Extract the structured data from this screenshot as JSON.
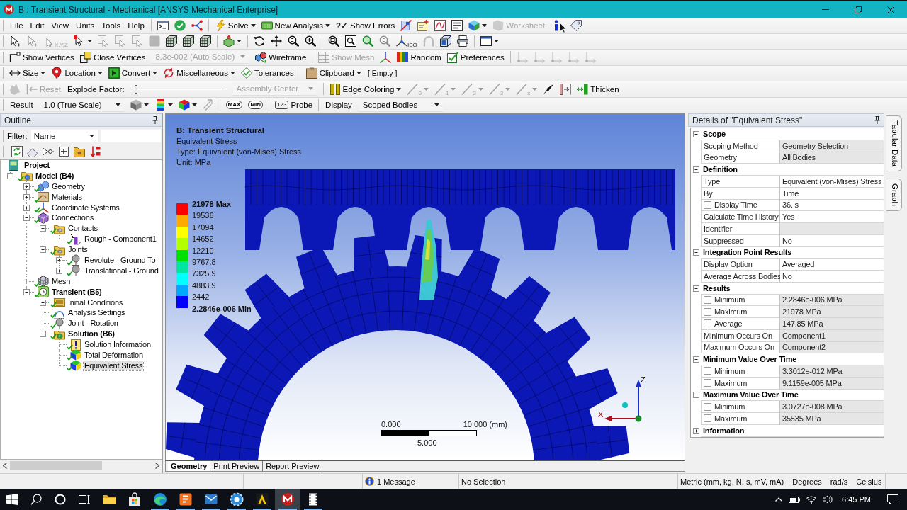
{
  "window": {
    "title": "B : Transient Structural - Mechanical [ANSYS Mechanical Enterprise]"
  },
  "menu_bar": [
    "File",
    "Edit",
    "View",
    "Units",
    "Tools",
    "Help"
  ],
  "toolbar_rows": [
    {
      "groups": [
        [
          {
            "kind": "console",
            "disabled": false
          },
          {
            "kind": "check",
            "disabled": false
          },
          {
            "kind": "graph",
            "disabled": false
          }
        ],
        [
          {
            "kind": "solve",
            "label": "Solve",
            "menu": true,
            "disabled": false
          },
          {
            "kind": "analysis",
            "label": "New Analysis",
            "menu": true,
            "disabled": false
          },
          {
            "kind": "errors",
            "badge": "?✓",
            "label": "Show Errors",
            "disabled": false
          },
          {
            "kind": "section",
            "disabled": false
          },
          {
            "kind": "annotation",
            "disabled": false
          },
          {
            "kind": "chart",
            "disabled": false
          },
          {
            "kind": "textbox",
            "disabled": false
          },
          {
            "kind": "cube",
            "menu": true,
            "disabled": false
          },
          {
            "kind": "worksheet",
            "label": "Worksheet",
            "disabled": true
          },
          {
            "kind": "info",
            "disabled": false
          },
          {
            "kind": "tag",
            "disabled": false
          }
        ]
      ]
    },
    {
      "groups": [
        [
          {
            "kind": "select",
            "disabled": false
          },
          {
            "kind": "select",
            "disabled": true
          },
          {
            "kind": "coords",
            "badge": "X,Y,Z",
            "disabled": true
          },
          {
            "kind": "mode",
            "menu": true,
            "disabled": false
          },
          {
            "kind": "face",
            "disabled": true
          },
          {
            "kind": "face",
            "disabled": true
          },
          {
            "kind": "face",
            "disabled": true
          },
          {
            "kind": "block",
            "disabled": true
          },
          {
            "kind": "lattice",
            "disabled": false
          },
          {
            "kind": "lattice",
            "disabled": false
          },
          {
            "kind": "lattice",
            "disabled": false
          }
        ],
        [
          {
            "kind": "extend",
            "menu": true,
            "disabled": false
          }
        ],
        [
          {
            "kind": "rotate",
            "disabled": false
          },
          {
            "kind": "pan",
            "disabled": false
          },
          {
            "kind": "zoom",
            "disabled": false
          },
          {
            "kind": "zoomin",
            "disabled": false
          }
        ],
        [
          {
            "kind": "zoombox",
            "disabled": false
          },
          {
            "kind": "zoomfit",
            "disabled": false
          },
          {
            "kind": "zoomgo",
            "disabled": false
          },
          {
            "kind": "zoom",
            "disabled": true
          },
          {
            "kind": "iso",
            "badge": "ISO",
            "disabled": false
          },
          {
            "kind": "back",
            "disabled": true
          },
          {
            "kind": "box",
            "disabled": false
          },
          {
            "kind": "print",
            "disabled": false
          }
        ],
        [
          {
            "kind": "window",
            "menu": true,
            "disabled": false
          }
        ]
      ]
    },
    {
      "groups": [
        [
          {
            "kind": "vertex",
            "label": "Show Vertices",
            "disabled": false
          },
          {
            "kind": "merge",
            "label": "Close Vertices",
            "disabled": false
          },
          {
            "kind": "combo",
            "value": "8.3e-002 (Auto Scale)",
            "disabled": true
          },
          {
            "kind": "wireframe",
            "label": "Wireframe",
            "disabled": false
          }
        ],
        [
          {
            "kind": "mesh",
            "label": "Show Mesh",
            "disabled": true
          },
          {
            "kind": "triad",
            "disabled": false
          },
          {
            "kind": "palette",
            "label": "Random",
            "disabled": false
          },
          {
            "kind": "preferences",
            "label": "Preferences",
            "disabled": false
          }
        ],
        [
          {
            "kind": "axes",
            "disabled": true
          },
          {
            "kind": "axes",
            "disabled": true
          },
          {
            "kind": "axes",
            "disabled": true
          },
          {
            "kind": "axes",
            "disabled": true
          },
          {
            "kind": "axes",
            "disabled": true
          }
        ]
      ]
    },
    {
      "groups": [
        [
          {
            "kind": "size",
            "label": "Size",
            "menu": true,
            "disabled": false
          },
          {
            "kind": "location",
            "label": "Location",
            "menu": true,
            "disabled": false
          },
          {
            "kind": "convert",
            "label": "Convert",
            "menu": true,
            "disabled": false
          },
          {
            "kind": "misc",
            "label": "Miscellaneous",
            "menu": true,
            "disabled": false
          },
          {
            "kind": "tolerance",
            "label": "Tolerances",
            "disabled": false
          }
        ],
        [
          {
            "kind": "clipboard",
            "label": "Clipboard",
            "menu": true,
            "disabled": false
          },
          {
            "kind": "note",
            "label": "[ Empty ]",
            "disabled": false
          }
        ]
      ]
    },
    {
      "groups": [
        [
          {
            "kind": "explode",
            "disabled": true
          },
          {
            "kind": "reset",
            "label": "Reset",
            "disabled": true
          },
          {
            "kind": "text",
            "label": "Explode Factor:",
            "disabled": false
          },
          {
            "kind": "slider",
            "level": 0
          },
          {
            "kind": "combo",
            "value": "Assembly Center",
            "disabled": true
          }
        ],
        [
          {
            "kind": "edges",
            "label": "Edge Coloring",
            "menu": true,
            "disabled": false
          },
          {
            "kind": "edge",
            "badge": "0",
            "menu": true,
            "disabled": true
          },
          {
            "kind": "edge",
            "badge": "1",
            "menu": true,
            "disabled": true
          },
          {
            "kind": "edge",
            "badge": "2",
            "menu": true,
            "disabled": true
          },
          {
            "kind": "edge",
            "badge": "3",
            "menu": true,
            "disabled": true
          },
          {
            "kind": "edge",
            "badge": "x",
            "menu": true,
            "disabled": true
          },
          {
            "kind": "pin",
            "disabled": false
          },
          {
            "kind": "shell",
            "disabled": false
          },
          {
            "kind": "thicken",
            "label": "Thicken",
            "disabled": false
          }
        ]
      ]
    },
    {
      "groups": [
        [
          {
            "kind": "text",
            "label": "Result",
            "disabled": false
          },
          {
            "kind": "combo",
            "value": "1.0 (True Scale)",
            "disabled": false
          },
          {
            "kind": "solid",
            "menu": true,
            "disabled": false
          },
          {
            "kind": "legend",
            "menu": true,
            "disabled": false
          },
          {
            "kind": "contour",
            "menu": true,
            "disabled": false
          },
          {
            "kind": "vectors",
            "disabled": true
          }
        ],
        [
          {
            "kind": "marker",
            "label": "MAX",
            "disabled": false
          },
          {
            "kind": "marker",
            "label": "MIN",
            "disabled": false
          }
        ],
        [
          {
            "kind": "probe",
            "badge": "123",
            "label": "Probe",
            "disabled": false
          }
        ],
        [
          {
            "kind": "text",
            "label": "Display",
            "disabled": false
          },
          {
            "kind": "combo",
            "value": "Scoped Bodies",
            "disabled": false
          }
        ]
      ]
    }
  ],
  "outline": {
    "title": "Outline",
    "filter": {
      "label": "Filter:",
      "value": "Name"
    },
    "tree": [
      {
        "label": "Project",
        "kind": "project",
        "bold": true,
        "complete": false,
        "selected": false,
        "children": [
          {
            "label": "Model (B4)",
            "kind": "model",
            "bold": true,
            "complete": true,
            "expanded": true,
            "selected": false,
            "children": [
              {
                "label": "Geometry",
                "kind": "geometry",
                "bold": false,
                "complete": true,
                "expanded": false,
                "selected": false
              },
              {
                "label": "Materials",
                "kind": "materials",
                "bold": false,
                "complete": true,
                "expanded": false,
                "selected": false
              },
              {
                "label": "Coordinate Systems",
                "kind": "coordinates",
                "bold": false,
                "complete": true,
                "expanded": false,
                "selected": false
              },
              {
                "label": "Connections",
                "kind": "connections",
                "bold": false,
                "complete": true,
                "expanded": true,
                "selected": false,
                "children": [
                  {
                    "label": "Contacts",
                    "kind": "group",
                    "bold": false,
                    "complete": true,
                    "expanded": true,
                    "selected": false,
                    "children": [
                      {
                        "label": "Rough - Component1",
                        "kind": "contact",
                        "bold": false,
                        "complete": true,
                        "selected": false
                      }
                    ]
                  },
                  {
                    "label": "Joints",
                    "kind": "group",
                    "bold": false,
                    "complete": true,
                    "expanded": true,
                    "selected": false,
                    "children": [
                      {
                        "label": "Revolute - Ground To",
                        "kind": "joint",
                        "bold": false,
                        "complete": true,
                        "expanded": false,
                        "selected": false
                      },
                      {
                        "label": "Translational - Ground",
                        "kind": "joint",
                        "bold": false,
                        "complete": true,
                        "expanded": false,
                        "selected": false
                      }
                    ]
                  }
                ]
              },
              {
                "label": "Mesh",
                "kind": "mesh",
                "bold": false,
                "complete": true,
                "selected": false
              },
              {
                "label": "Transient (B5)",
                "kind": "transient",
                "bold": true,
                "complete": true,
                "expanded": true,
                "selected": false,
                "children": [
                  {
                    "label": "Initial Conditions",
                    "kind": "initial",
                    "bold": false,
                    "complete": true,
                    "expanded": false,
                    "selected": false
                  },
                  {
                    "label": "Analysis Settings",
                    "kind": "settings",
                    "bold": false,
                    "complete": true,
                    "selected": false
                  },
                  {
                    "label": "Joint - Rotation",
                    "kind": "joint",
                    "bold": false,
                    "complete": true,
                    "selected": false
                  },
                  {
                    "label": "Solution (B6)",
                    "kind": "solution",
                    "bold": true,
                    "complete": true,
                    "expanded": true,
                    "selected": false,
                    "children": [
                      {
                        "label": "Solution Information",
                        "kind": "info",
                        "bold": false,
                        "complete": true,
                        "selected": false
                      },
                      {
                        "label": "Total Deformation",
                        "kind": "result",
                        "bold": false,
                        "complete": true,
                        "selected": false
                      },
                      {
                        "label": "Equivalent Stress",
                        "kind": "result",
                        "bold": false,
                        "complete": true,
                        "selected": true
                      }
                    ]
                  }
                ]
              }
            ]
          }
        ]
      }
    ]
  },
  "viewport": {
    "heading": "B: Transient Structural",
    "lines": [
      "Equivalent Stress",
      "Type: Equivalent (von-Mises) Stress",
      "Unit: MPa"
    ],
    "legend": {
      "bands": [
        {
          "color": "#ff0000"
        },
        {
          "color": "#ffaa00"
        },
        {
          "color": "#ffff00"
        },
        {
          "color": "#b4ff00"
        },
        {
          "color": "#00e000"
        },
        {
          "color": "#00e6a0"
        },
        {
          "color": "#00ffff"
        },
        {
          "color": "#00a8ff"
        },
        {
          "color": "#0000ff"
        }
      ],
      "labels": [
        "21978 Max",
        "19536",
        "17094",
        "14652",
        "12210",
        "9767.8",
        "7325.9",
        "4883.9",
        "2442",
        "2.2846e-006 Min"
      ]
    },
    "scale": {
      "start": "0.000",
      "end": "10.000 (mm)",
      "middle": "5.000"
    },
    "triad": {
      "z": "Z",
      "x": "X"
    },
    "tabs": [
      {
        "label": "Geometry",
        "selected": true
      },
      {
        "label": "Print Preview",
        "selected": false
      },
      {
        "label": "Report Preview",
        "selected": false
      }
    ]
  },
  "details": {
    "title": "Details of \"Equivalent Stress\"",
    "groups": [
      {
        "name": "Scope",
        "expanded": true,
        "rows": [
          {
            "kind": "field",
            "label": "Scoping Method",
            "value": "Geometry Selection",
            "readonly": true
          },
          {
            "kind": "field",
            "label": "Geometry",
            "value": "All Bodies",
            "readonly": true
          }
        ]
      },
      {
        "name": "Definition",
        "expanded": true,
        "rows": [
          {
            "kind": "field",
            "label": "Type",
            "value": "Equivalent (von-Mises) Stress",
            "readonly": false
          },
          {
            "kind": "field",
            "label": "By",
            "value": "Time",
            "readonly": false
          },
          {
            "kind": "check",
            "label": "Display Time",
            "value": "36. s",
            "readonly": false,
            "checked": false
          },
          {
            "kind": "field",
            "label": "Calculate Time History",
            "value": "Yes",
            "readonly": false
          },
          {
            "kind": "field",
            "label": "Identifier",
            "readonly": true
          },
          {
            "kind": "field",
            "label": "Suppressed",
            "value": "No",
            "readonly": false
          }
        ]
      },
      {
        "name": "Integration Point Results",
        "expanded": true,
        "rows": [
          {
            "kind": "field",
            "label": "Display Option",
            "value": "Averaged",
            "readonly": false
          },
          {
            "kind": "field",
            "label": "Average Across Bodies",
            "value": "No",
            "readonly": false
          }
        ]
      },
      {
        "name": "Results",
        "expanded": true,
        "rows": [
          {
            "kind": "check",
            "label": "Minimum",
            "value": "2.2846e-006 MPa",
            "readonly": true,
            "checked": false
          },
          {
            "kind": "check",
            "label": "Maximum",
            "value": "21978 MPa",
            "readonly": true,
            "checked": false
          },
          {
            "kind": "check",
            "label": "Average",
            "value": "147.85 MPa",
            "readonly": true,
            "checked": false
          },
          {
            "kind": "field",
            "label": "Minimum Occurs On",
            "value": "Component1",
            "readonly": true
          },
          {
            "kind": "field",
            "label": "Maximum Occurs On",
            "value": "Component2",
            "readonly": true
          }
        ]
      },
      {
        "name": "Minimum Value Over Time",
        "expanded": true,
        "rows": [
          {
            "kind": "check",
            "label": "Minimum",
            "value": "3.3012e-012 MPa",
            "readonly": true,
            "checked": false
          },
          {
            "kind": "check",
            "label": "Maximum",
            "value": "9.1159e-005 MPa",
            "readonly": true,
            "checked": false
          }
        ]
      },
      {
        "name": "Maximum Value Over Time",
        "expanded": true,
        "rows": [
          {
            "kind": "check",
            "label": "Minimum",
            "value": "3.0727e-008 MPa",
            "readonly": true,
            "checked": false
          },
          {
            "kind": "check",
            "label": "Maximum",
            "value": "35535 MPa",
            "readonly": true,
            "checked": false
          }
        ]
      },
      {
        "name": "Information",
        "expanded": false
      }
    ]
  },
  "side_tabs": [
    {
      "label": "Tabular Data",
      "selected": false
    },
    {
      "label": "Graph",
      "selected": false
    }
  ],
  "status_bar": {
    "message": "1 Message",
    "selection": "No Selection",
    "units": "Metric (mm, kg, N, s, mV, mA)",
    "angle": "Degrees",
    "rate": "rad/s",
    "temperature": "Celsius"
  },
  "taskbar": {
    "apps": [
      {
        "kind": "explorer",
        "running": false,
        "active": false
      },
      {
        "kind": "store",
        "running": false,
        "active": false
      },
      {
        "kind": "browser",
        "running": true,
        "active": false
      },
      {
        "kind": "tile",
        "running": true,
        "active": false
      },
      {
        "kind": "mail",
        "running": true,
        "active": false
      },
      {
        "kind": "gear",
        "running": true,
        "active": false
      },
      {
        "kind": "triangle",
        "running": true,
        "active": false
      },
      {
        "kind": "logo",
        "running": true,
        "active": true
      },
      {
        "kind": "film",
        "running": true,
        "active": false
      }
    ],
    "clock": "6:45 PM"
  }
}
